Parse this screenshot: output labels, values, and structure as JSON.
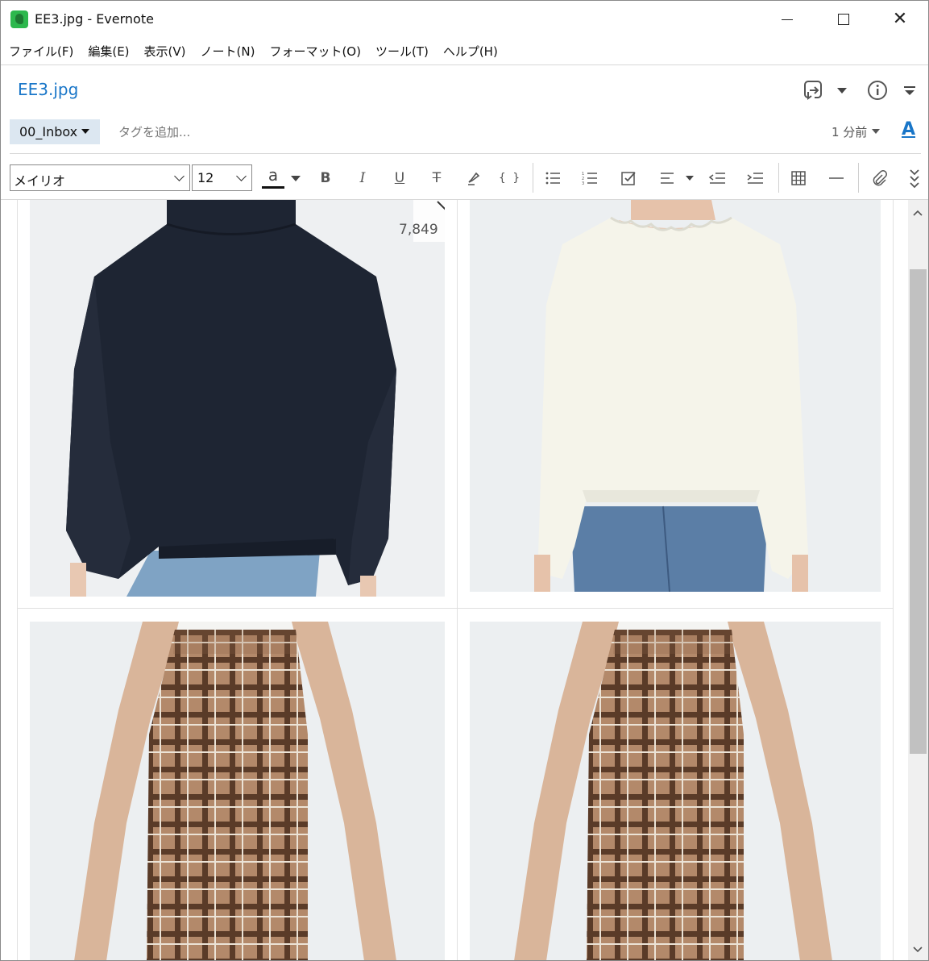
{
  "window": {
    "title": "EE3.jpg - Evernote",
    "minimize_icon": "minimize-icon",
    "maximize_icon": "maximize-icon",
    "close_icon": "close-icon",
    "close_glyph": "✕"
  },
  "menu": [
    "ファイル(F)",
    "編集(E)",
    "表示(V)",
    "ノート(N)",
    "フォーマット(O)",
    "ツール(T)",
    "ヘルプ(H)"
  ],
  "note": {
    "title": "EE3.jpg",
    "notebook": "00_Inbox",
    "tag_placeholder": "タグを追加...",
    "updated": "1 分前",
    "font_button": "A"
  },
  "toolbar": {
    "font_family": "メイリオ",
    "font_size": "12",
    "text_color_glyph": "a",
    "bold": "B",
    "italic": "I",
    "underline": "U",
    "strikethrough": "T",
    "code": "{ }"
  },
  "content": {
    "favorite_count": "7,849"
  },
  "colors": {
    "accent": "#1976c8",
    "tag_bg": "#dce7f1",
    "navy_sweater": "#1e2533",
    "cream_sweater": "#f5f4ea",
    "denim": "#5b7ea6",
    "plaid_base": "#b3896a",
    "plaid_dark": "#5a3b28"
  }
}
